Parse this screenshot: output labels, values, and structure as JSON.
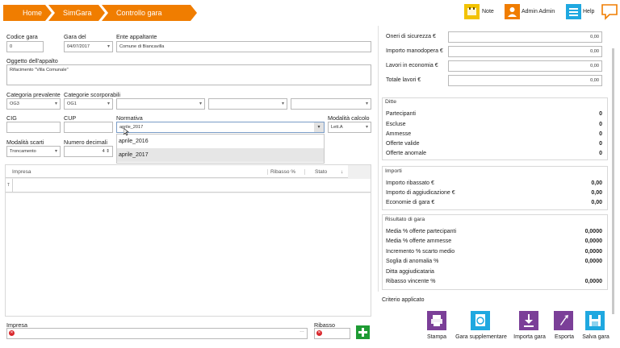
{
  "breadcrumb": [
    "Home",
    "SimGara",
    "Controllo gara"
  ],
  "toolbar": {
    "note": "Note",
    "user": "Admin Admin",
    "help": "Help"
  },
  "colors": {
    "orange": "#f07d00",
    "purple": "#7b3f98",
    "cyan": "#1fa8e0",
    "yellow": "#f2c200",
    "green": "#1e9b34"
  },
  "form": {
    "codice_label": "Codice gara",
    "codice_value": "0",
    "garadel_label": "Gara del",
    "garadel_value": "04/07/2017",
    "ente_label": "Ente appaltante",
    "ente_value": "Comune di Biancavilla",
    "oggetto_label": "Oggetto dell'appalto",
    "oggetto_value": "Rifacimento \"Villa Comunale\"",
    "catprev_label": "Categoria prevalente",
    "catprev_value": "OG3",
    "catscorp_label": "Categorie scorporabili",
    "catscorp_value": "OG1",
    "cig_label": "CIG",
    "cup_label": "CUP",
    "normativa_label": "Normativa",
    "normativa_value": "aprile_2017",
    "modcalc_label": "Modalità calcolo",
    "modcalc_value": "Lett.A",
    "modscarti_label": "Modalità scarti",
    "modscarti_value": "Troncamento",
    "numdec_label": "Numero decimali",
    "numdec_value": "4"
  },
  "dropdown": {
    "options": [
      "aprile_2016",
      "aprile_2017"
    ]
  },
  "table": {
    "headers": [
      "Impresa",
      "Ribasso %",
      "Stato"
    ]
  },
  "bottom": {
    "impresa_label": "Impresa",
    "ribasso_label": "Ribasso"
  },
  "costs": [
    {
      "label": "Oneri di sicurezza €",
      "value": "0,00"
    },
    {
      "label": "Importo manodopera €",
      "value": "0,00"
    },
    {
      "label": "Lavori in economia €",
      "value": "0,00"
    },
    {
      "label": "Totale lavori €",
      "value": "0,00"
    }
  ],
  "ditte": {
    "title": "Ditte",
    "rows": [
      {
        "label": "Partecipanti",
        "value": "0"
      },
      {
        "label": "Escluse",
        "value": "0"
      },
      {
        "label": "Ammesse",
        "value": "0"
      },
      {
        "label": "Offerte valide",
        "value": "0"
      },
      {
        "label": "Offerte anomale",
        "value": "0"
      }
    ]
  },
  "importi": {
    "title": "Importi",
    "rows": [
      {
        "label": "Importo ribassato €",
        "value": "0,00"
      },
      {
        "label": "Importo di aggiudicazione €",
        "value": "0,00"
      },
      {
        "label": "Economie di gara €",
        "value": "0,00"
      }
    ]
  },
  "risultato": {
    "title": "Risultato di gara",
    "rows": [
      {
        "label": "Media % offerte partecipanti",
        "value": "0,0000"
      },
      {
        "label": "Media % offerte ammesse",
        "value": "0,0000"
      },
      {
        "label": "Incremento % scarto medio",
        "value": "0,0000"
      },
      {
        "label": "Soglia di anomalia %",
        "value": "0,0000"
      },
      {
        "label": "Ditta aggiudicataria",
        "value": ""
      },
      {
        "label": "Ribasso vincente %",
        "value": "0,0000"
      }
    ]
  },
  "criterio_label": "Criterio applicato",
  "actions": [
    "Stampa",
    "Gara supplementare",
    "Importa gara",
    "Esporta",
    "Salva gara"
  ]
}
